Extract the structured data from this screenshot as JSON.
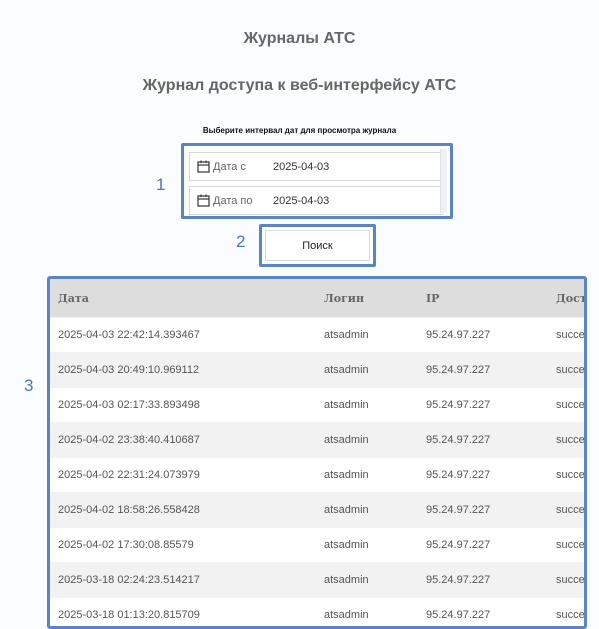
{
  "page": {
    "title": "Журналы АТС",
    "subtitle": "Журнал доступа к веб-интерфейсу АТС"
  },
  "filters": {
    "hint": "Выберите интервал дат для просмотра журнала",
    "from_label": "Дата с",
    "from_value": "2025-04-03",
    "to_label": "Дата по",
    "to_value": "2025-04-03",
    "calendar_icon": "calendar-icon"
  },
  "search": {
    "label": "Поиск"
  },
  "markers": [
    "1",
    "2",
    "3"
  ],
  "table": {
    "columns": [
      "Дата",
      "Логин",
      "IP",
      "Доступ"
    ],
    "rows": [
      [
        "2025-04-03 22:42:14.393467",
        "atsadmin",
        "95.24.97.227",
        "success"
      ],
      [
        "2025-04-03 20:49:10.969112",
        "atsadmin",
        "95.24.97.227",
        "success"
      ],
      [
        "2025-04-03 02:17:33.893498",
        "atsadmin",
        "95.24.97.227",
        "success"
      ],
      [
        "2025-04-02 23:38:40.410687",
        "atsadmin",
        "95.24.97.227",
        "success"
      ],
      [
        "2025-04-02 22:31:24.073979",
        "atsadmin",
        "95.24.97.227",
        "success"
      ],
      [
        "2025-04-02 18:58:26.558428",
        "atsadmin",
        "95.24.97.227",
        "success"
      ],
      [
        "2025-04-02 17:30:08.85579",
        "atsadmin",
        "95.24.97.227",
        "success"
      ],
      [
        "2025-03-18 02:24:23.514217",
        "atsadmin",
        "95.24.97.227",
        "success"
      ],
      [
        "2025-03-18 01:13:20.815709",
        "atsadmin",
        "95.24.97.227",
        "success"
      ]
    ]
  },
  "colors": {
    "accent": "#5b84c4",
    "header_bg": "#dddddd",
    "stripe": "#f2f2f2",
    "marker": "#4a79b8"
  }
}
